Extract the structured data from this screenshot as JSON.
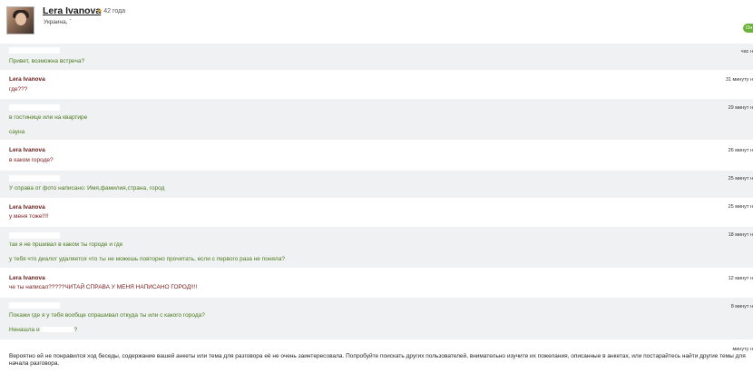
{
  "profile": {
    "name": "Lera Ivanova",
    "age": "42 года",
    "location": "Украина, ˉ",
    "online_badge": "Он"
  },
  "messages": [
    {
      "time": "час н",
      "lines": [
        "Привет, возможна встреча?"
      ]
    },
    {
      "author": "Lera Ivanova",
      "time": "31 минуту н",
      "lines": [
        "где???"
      ]
    },
    {
      "time": "29 минут н",
      "lines": [
        "в гостинице или на квартире",
        "сауна"
      ]
    },
    {
      "author": "Lera Ivanova",
      "time": "26 минут н",
      "lines": [
        "в каком городе?"
      ]
    },
    {
      "time": "25 минут н",
      "lines": [
        "У справа от фото написано: Имя,фамилия,страна, город"
      ]
    },
    {
      "author": "Lera Ivanova",
      "time": "25 минут н",
      "lines": [
        "у меня тоже!!!!"
      ]
    },
    {
      "time": "18 минут н",
      "lines": [
        "так я не пршивал в каком ты городе и где",
        "у тебя что диалог удаляется что ты не можешь повторно прочитать, если с первого раза не поняла?"
      ]
    },
    {
      "author": "Lera Ivanova",
      "time": "12 минут н",
      "lines": [
        "че ты написал?????ЧИТАЙ СПРАВА У МЕНЯ НАПИСАНО ГОРОД!!!!"
      ]
    },
    {
      "time": "8 минут н",
      "lines": [
        "Покажи где я у тебя вообще спрашивал откуда ты или с какого города?",
        "Ненашла и",
        "?"
      ]
    }
  ],
  "notice": {
    "time": "минуту н",
    "text": "Вероятно ей не понравился ход беседы, содержание вашей анкеты или тема для разговора её не очень заинтересовала. Попробуйте поискать других пользователей, внимательно изучите их пожелания, описанные в анкетах, или постарайтесь найти другие темы для начала разговора."
  },
  "colors": {
    "row_gray": "#f0f1f3",
    "author_color": "#6b1c1c",
    "sender_text": "#4b7a1e",
    "online_green": "#6cb33e"
  }
}
